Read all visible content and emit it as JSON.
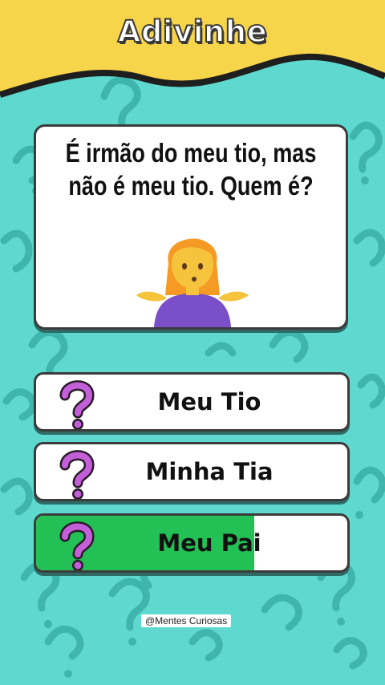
{
  "header": {
    "title": "Adivinhe"
  },
  "question": {
    "text": "É irmão do meu tio, mas não é meu tio. Quem é?"
  },
  "options": [
    {
      "label": "Meu Tio",
      "selected": false,
      "fill": 0
    },
    {
      "label": "Minha Tia",
      "selected": false,
      "fill": 0
    },
    {
      "label": "Meu Pai",
      "selected": true,
      "fill": 0.7
    }
  ],
  "credit": {
    "text": "@Mentes Curiosas"
  },
  "colors": {
    "background": "#5fd9cf",
    "banner": "#f7d54a",
    "pattern": "#3fb6ad",
    "answer_fill": "#22c055",
    "question_icon": "#c35fd8"
  },
  "icons": {
    "option_icon": "question-mark-icon",
    "illustration": "shrugging-woman-illustration"
  }
}
